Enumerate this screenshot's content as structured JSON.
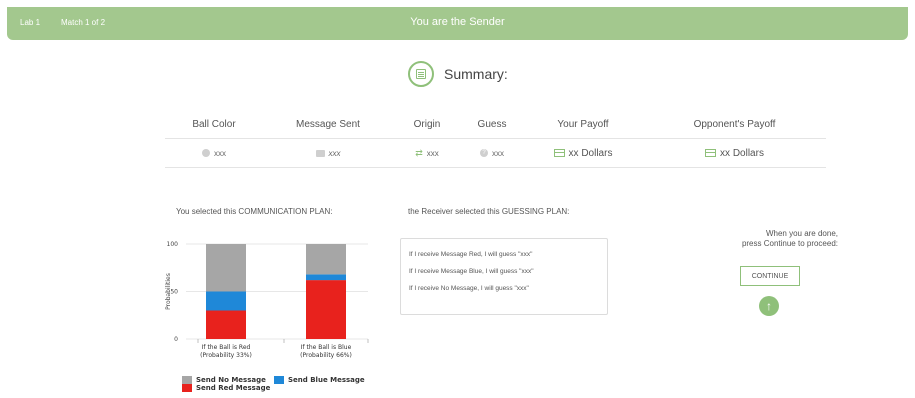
{
  "topbar": {
    "lab": "Lab 1",
    "match": "Match 1 of 2",
    "title": "You are the Sender"
  },
  "summary": {
    "title": "Summary:",
    "headers": [
      "Ball Color",
      "Message Sent",
      "Origin",
      "Guess",
      "Your Payoff",
      "Opponent's Payoff"
    ],
    "values": [
      "xxx",
      "xxx",
      "xxx",
      "xxx",
      "xx Dollars",
      "xx Dollars"
    ]
  },
  "labels": {
    "comm": "You selected this COMMUNICATION PLAN:",
    "guess": "the Receiver selected this GUESSING PLAN:"
  },
  "guessing_plan": [
    "If I receive Message Red, I will guess \"xxx\"",
    "If I receive Message Blue, I will guess \"xxx\"",
    "If I receive No Message, I will guess \"xxx\""
  ],
  "done": {
    "line1": "When you are done,",
    "line2": "press Continue to proceed:",
    "button": "CONTINUE"
  },
  "colors": {
    "accent": "#a3c88e",
    "red": "#e8221d",
    "blue": "#1f88d8",
    "gray": "#a6a6a6"
  },
  "icons": [
    "summary-icon",
    "ball-icon",
    "envelope-icon",
    "shuffle-icon",
    "question-icon",
    "card-icon",
    "up-arrow-icon"
  ],
  "chart_data": {
    "type": "bar",
    "stacked": true,
    "ylabel": "Probabilities",
    "ylim": [
      0,
      100
    ],
    "yticks": [
      0,
      50,
      100
    ],
    "categories": [
      "If the Ball is Red\n(Probability 33%)",
      "If the Ball is Blue\n(Probability 66%)"
    ],
    "categories_line1": [
      "If the Ball is Red",
      "If the Ball is Blue"
    ],
    "categories_line2": [
      "(Probability 33%)",
      "(Probability 66%)"
    ],
    "series": [
      {
        "name": "Send Red Message",
        "color": "#e8221d",
        "values": [
          30,
          62
        ]
      },
      {
        "name": "Send Blue Message",
        "color": "#1f88d8",
        "values": [
          20,
          6
        ]
      },
      {
        "name": "Send No Message",
        "color": "#a6a6a6",
        "values": [
          50,
          32
        ]
      }
    ]
  }
}
